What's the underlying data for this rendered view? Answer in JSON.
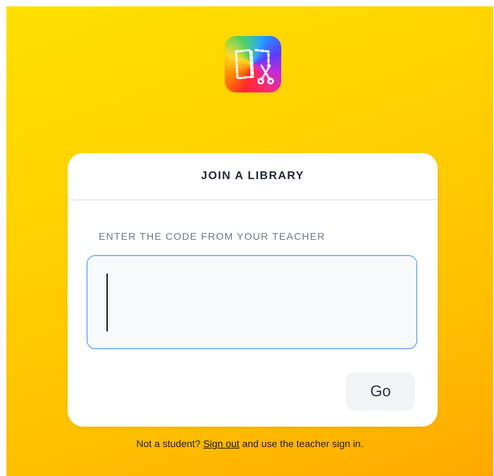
{
  "app": {
    "logo_icon": "book-creator-logo-icon"
  },
  "card": {
    "title": "JOIN A LIBRARY",
    "field_label": "ENTER THE CODE FROM YOUR TEACHER",
    "code_input": {
      "value": "",
      "placeholder": ""
    },
    "go_label": "Go"
  },
  "footer": {
    "prefix": "Not a student?",
    "link_text": "Sign out",
    "suffix": "and use the teacher sign in."
  },
  "colors": {
    "background_gradient": [
      "#ffe000",
      "#ffa800"
    ],
    "input_border": "#3d8cf0",
    "card_background": "#ffffff"
  }
}
